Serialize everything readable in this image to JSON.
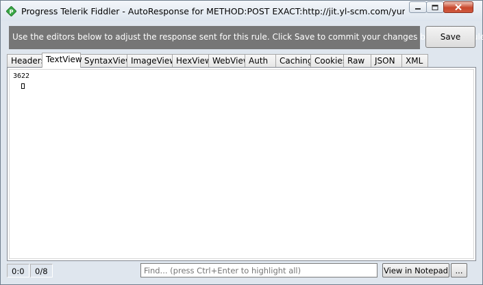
{
  "window": {
    "title": "Progress Telerik Fiddler - AutoResponse for METHOD:POST EXACT:http://jit.yl-scm.com/yunlu-ti..."
  },
  "banner": {
    "text": "Use the editors below to adjust the response sent for this rule. Click Save to commit your changes back to the rule."
  },
  "toolbar": {
    "save_label": "Save"
  },
  "tabs": [
    {
      "label": "Headers"
    },
    {
      "label": "TextView"
    },
    {
      "label": "SyntaxView"
    },
    {
      "label": "ImageView"
    },
    {
      "label": "HexView"
    },
    {
      "label": "WebView"
    },
    {
      "label": "Auth"
    },
    {
      "label": "Caching"
    },
    {
      "label": "Cookies"
    },
    {
      "label": "Raw"
    },
    {
      "label": "JSON"
    },
    {
      "label": "XML"
    }
  ],
  "active_tab": "TextView",
  "editor": {
    "content": "3622"
  },
  "status": {
    "position": "0:0",
    "selection": "0/8",
    "find_placeholder": "Find... (press Ctrl+Enter to highlight all)",
    "view_notepad_label": "View in Notepad",
    "more_label": "..."
  },
  "icons": {
    "app": "fiddler-app-icon",
    "minimize": "minimize-icon",
    "maximize": "maximize-icon",
    "close": "close-icon"
  }
}
